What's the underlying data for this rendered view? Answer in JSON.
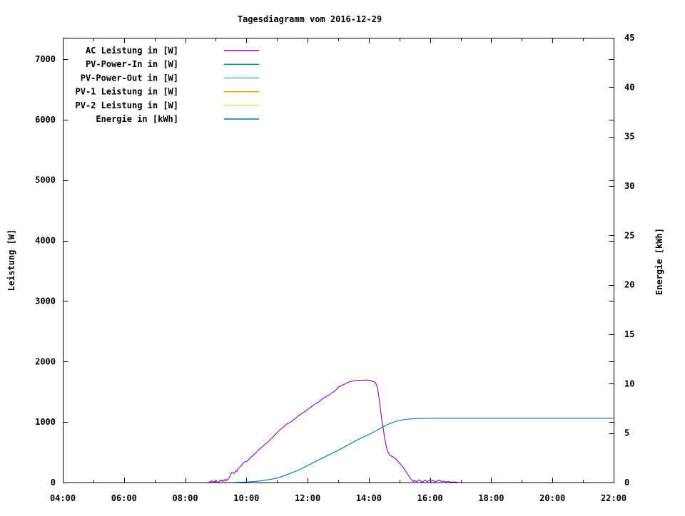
{
  "chart_data": {
    "type": "line",
    "title": "Tagesdiagramm vom 2016-12-29",
    "background": "#ffffff",
    "grid": false,
    "legend_position": "top-left-inside",
    "x_axis": {
      "range_hours": [
        4,
        22
      ],
      "major_ticks": [
        {
          "hour": 4,
          "label": "04:00"
        },
        {
          "hour": 6,
          "label": "06:00"
        },
        {
          "hour": 8,
          "label": "08:00"
        },
        {
          "hour": 10,
          "label": "10:00"
        },
        {
          "hour": 12,
          "label": "12:00"
        },
        {
          "hour": 14,
          "label": "14:00"
        },
        {
          "hour": 16,
          "label": "16:00"
        },
        {
          "hour": 18,
          "label": "18:00"
        },
        {
          "hour": 20,
          "label": "20:00"
        },
        {
          "hour": 22,
          "label": "22:00"
        }
      ],
      "minor_tick_hours": [
        5,
        7,
        9,
        11,
        13,
        15,
        17,
        19,
        21
      ]
    },
    "y_left_axis": {
      "label": "Leistung [W]",
      "tick_values": [
        0,
        1000,
        2000,
        3000,
        4000,
        5000,
        6000,
        7000
      ],
      "range": [
        0,
        7353
      ]
    },
    "y_right_axis": {
      "label": "Energie [kWh]",
      "tick_values": [
        0,
        5,
        10,
        15,
        20,
        25,
        30,
        35,
        40,
        45
      ],
      "range": [
        0,
        45
      ]
    },
    "legend": [
      {
        "label": "AC Leistung in [W]",
        "color": "#9400d3"
      },
      {
        "label": "PV-Power-In in [W]",
        "color": "#009e73"
      },
      {
        "label": "PV-Power-Out in [W]",
        "color": "#56b4e9"
      },
      {
        "label": "PV-1 Leistung in [W]",
        "color": "#e69f00"
      },
      {
        "label": "PV-2 Leistung in [W]",
        "color": "#f0e442"
      },
      {
        "label": "Energie in [kWh]",
        "color": "#0072b2"
      }
    ],
    "series": [
      {
        "name": "AC Leistung in [W]",
        "color": "#9400d3",
        "y_axis": "left",
        "points": [
          [
            8.78,
            0
          ],
          [
            8.81,
            20
          ],
          [
            8.84,
            8
          ],
          [
            8.87,
            28
          ],
          [
            8.9,
            12
          ],
          [
            8.93,
            4
          ],
          [
            8.96,
            24
          ],
          [
            8.99,
            10
          ],
          [
            9.02,
            32
          ],
          [
            9.05,
            6
          ],
          [
            9.08,
            0
          ],
          [
            9.11,
            18
          ],
          [
            9.14,
            36
          ],
          [
            9.17,
            22
          ],
          [
            9.2,
            42
          ],
          [
            9.23,
            16
          ],
          [
            9.26,
            34
          ],
          [
            9.29,
            48
          ],
          [
            9.32,
            26
          ],
          [
            9.35,
            52
          ],
          [
            9.38,
            38
          ],
          [
            9.41,
            60
          ],
          [
            9.44,
            85
          ],
          [
            9.47,
            115
          ],
          [
            9.5,
            148
          ],
          [
            9.53,
            172
          ],
          [
            9.56,
            158
          ],
          [
            9.6,
            150
          ],
          [
            9.63,
            162
          ],
          [
            9.66,
            200
          ],
          [
            9.69,
            185
          ],
          [
            9.72,
            218
          ],
          [
            9.76,
            240
          ],
          [
            9.8,
            262
          ],
          [
            9.85,
            296
          ],
          [
            9.9,
            320
          ],
          [
            9.95,
            348
          ],
          [
            10.0,
            340
          ],
          [
            10.05,
            368
          ],
          [
            10.1,
            395
          ],
          [
            10.2,
            440
          ],
          [
            10.3,
            487
          ],
          [
            10.4,
            540
          ],
          [
            10.5,
            585
          ],
          [
            10.6,
            628
          ],
          [
            10.7,
            672
          ],
          [
            10.8,
            718
          ],
          [
            10.9,
            770
          ],
          [
            11.0,
            825
          ],
          [
            11.1,
            872
          ],
          [
            11.2,
            912
          ],
          [
            11.3,
            960
          ],
          [
            11.4,
            986
          ],
          [
            11.5,
            1018
          ],
          [
            11.6,
            1062
          ],
          [
            11.7,
            1102
          ],
          [
            11.8,
            1138
          ],
          [
            11.9,
            1170
          ],
          [
            12.0,
            1205
          ],
          [
            12.1,
            1242
          ],
          [
            12.2,
            1282
          ],
          [
            12.3,
            1316
          ],
          [
            12.4,
            1345
          ],
          [
            12.5,
            1392
          ],
          [
            12.6,
            1420
          ],
          [
            12.7,
            1448
          ],
          [
            12.8,
            1482
          ],
          [
            12.9,
            1516
          ],
          [
            13.0,
            1578
          ],
          [
            13.1,
            1602
          ],
          [
            13.2,
            1625
          ],
          [
            13.3,
            1652
          ],
          [
            13.4,
            1668
          ],
          [
            13.5,
            1680
          ],
          [
            13.6,
            1688
          ],
          [
            13.7,
            1692
          ],
          [
            13.8,
            1690
          ],
          [
            13.9,
            1694
          ],
          [
            14.0,
            1690
          ],
          [
            14.08,
            1682
          ],
          [
            14.15,
            1672
          ],
          [
            14.22,
            1650
          ],
          [
            14.28,
            1570
          ],
          [
            14.33,
            1420
          ],
          [
            14.38,
            1220
          ],
          [
            14.43,
            1020
          ],
          [
            14.48,
            860
          ],
          [
            14.53,
            700
          ],
          [
            14.58,
            575
          ],
          [
            14.63,
            498
          ],
          [
            14.68,
            455
          ],
          [
            14.73,
            438
          ],
          [
            14.78,
            428
          ],
          [
            14.83,
            405
          ],
          [
            14.88,
            392
          ],
          [
            14.93,
            360
          ],
          [
            15.0,
            322
          ],
          [
            15.07,
            280
          ],
          [
            15.13,
            240
          ],
          [
            15.2,
            188
          ],
          [
            15.27,
            135
          ],
          [
            15.33,
            88
          ],
          [
            15.4,
            42
          ],
          [
            15.45,
            20
          ],
          [
            15.5,
            34
          ],
          [
            15.55,
            14
          ],
          [
            15.6,
            28
          ],
          [
            15.65,
            45
          ],
          [
            15.7,
            18
          ],
          [
            15.75,
            8
          ],
          [
            15.8,
            26
          ],
          [
            15.85,
            38
          ],
          [
            15.9,
            16
          ],
          [
            15.95,
            30
          ],
          [
            16.0,
            45
          ],
          [
            16.05,
            22
          ],
          [
            16.1,
            34
          ],
          [
            16.17,
            12
          ],
          [
            16.24,
            26
          ],
          [
            16.31,
            38
          ],
          [
            16.38,
            16
          ],
          [
            16.45,
            24
          ],
          [
            16.52,
            8
          ],
          [
            16.6,
            16
          ],
          [
            16.7,
            6
          ],
          [
            16.8,
            12
          ],
          [
            16.9,
            0
          ]
        ]
      },
      {
        "name": "Energie in [kWh]",
        "color": "#0072b2",
        "y_axis": "right",
        "points": [
          [
            9.58,
            0.0
          ],
          [
            9.8,
            0.02
          ],
          [
            10.0,
            0.05
          ],
          [
            10.25,
            0.1
          ],
          [
            10.5,
            0.18
          ],
          [
            10.75,
            0.3
          ],
          [
            11.0,
            0.45
          ],
          [
            11.25,
            0.7
          ],
          [
            11.5,
            1.0
          ],
          [
            11.75,
            1.33
          ],
          [
            12.0,
            1.71
          ],
          [
            12.25,
            2.1
          ],
          [
            12.5,
            2.5
          ],
          [
            12.75,
            2.88
          ],
          [
            13.0,
            3.25
          ],
          [
            13.25,
            3.67
          ],
          [
            13.5,
            4.1
          ],
          [
            13.75,
            4.5
          ],
          [
            14.0,
            4.85
          ],
          [
            14.15,
            5.1
          ],
          [
            14.3,
            5.35
          ],
          [
            14.45,
            5.62
          ],
          [
            14.6,
            5.85
          ],
          [
            14.75,
            6.05
          ],
          [
            14.9,
            6.2
          ],
          [
            15.05,
            6.3
          ],
          [
            15.2,
            6.38
          ],
          [
            15.35,
            6.43
          ],
          [
            15.5,
            6.46
          ],
          [
            15.7,
            6.48
          ],
          [
            15.9,
            6.49
          ],
          [
            16.2,
            6.5
          ],
          [
            17.0,
            6.5
          ],
          [
            18.0,
            6.5
          ],
          [
            19.0,
            6.5
          ],
          [
            20.0,
            6.5
          ],
          [
            21.0,
            6.5
          ],
          [
            22.0,
            6.5
          ]
        ]
      }
    ]
  }
}
